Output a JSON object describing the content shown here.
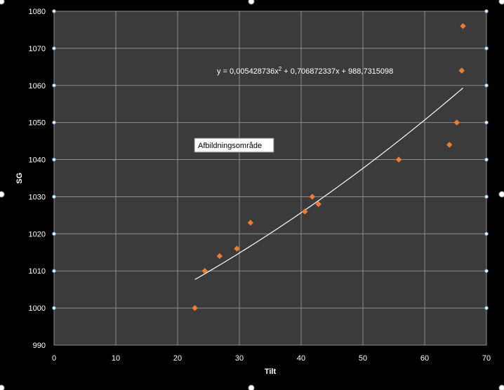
{
  "chart_data": {
    "type": "scatter",
    "title": "",
    "xlabel": "Tilt",
    "ylabel": "SG",
    "xlim": [
      0,
      70
    ],
    "ylim": [
      990,
      1080
    ],
    "x_ticks": [
      "0",
      "10",
      "20",
      "30",
      "40",
      "50",
      "60",
      "70"
    ],
    "y_ticks": [
      "990",
      "1000",
      "1010",
      "1020",
      "1030",
      "1040",
      "1050",
      "1060",
      "1070",
      "1080"
    ],
    "grid": true,
    "series": [
      {
        "marker": "diamond",
        "color": "#ed7d31",
        "x": [
          22.8,
          24.4,
          26.8,
          29.6,
          31.8,
          40.6,
          41.8,
          42.8,
          55.8,
          64.0,
          65.2,
          66.0,
          66.2
        ],
        "y": [
          1000,
          1010,
          1014,
          1016,
          1023,
          1026,
          1030,
          1028,
          1040,
          1044,
          1050,
          1064,
          1076
        ]
      }
    ],
    "trendline": {
      "type": "polynomial",
      "order": 2,
      "coefficients": [
        0.005428736,
        0.706872337,
        988.7315098
      ],
      "x_range": [
        22.8,
        66.2
      ],
      "color": "#ffffff"
    },
    "equation": {
      "prefix": "y = 0,005428736x",
      "superscript": "2",
      "suffix": " + 0,706872337x + 988,7315098"
    },
    "tooltip": "Afbildningsområde",
    "colors": {
      "plot_background": "#3b3b3b",
      "outer_background": "#000000",
      "gridline": "#8c8c8c",
      "handle": "#5b9bd5"
    }
  }
}
